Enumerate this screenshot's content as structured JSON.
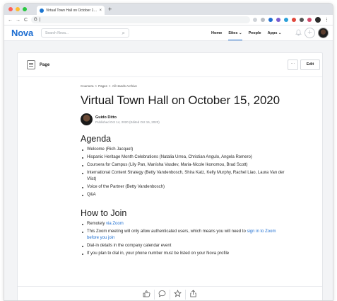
{
  "browser": {
    "tab_title": "Virtual Town Hall on October 1…",
    "tab_close": "×",
    "new_tab": "+",
    "address": "|",
    "back": "←",
    "forward": "→",
    "reload": "C",
    "lock": "G",
    "menu": "⋮"
  },
  "header": {
    "logo": "Nova",
    "search_placeholder": "Search Nova...",
    "search_icon": "⌕",
    "nav": [
      {
        "label": "Home"
      },
      {
        "label": "Sites ⌄"
      },
      {
        "label": "People"
      },
      {
        "label": "Apps ⌄"
      }
    ],
    "plus": "+",
    "bell": "🔔"
  },
  "card": {
    "page_label": "Page",
    "more": "···",
    "edit": "Edit"
  },
  "doc": {
    "breadcrumb": [
      "Coursera",
      ">",
      "Pages",
      ">",
      "All Hands Archive"
    ],
    "title": "Virtual Town Hall on October 15, 2020",
    "author_name": "Guido Ditto",
    "author_meta": "Published Oct 14, 2020 (Edited Oct 15, 2020)",
    "agenda_heading": "Agenda",
    "agenda_items": [
      "Welcome (Rich Jacquet)",
      "Hispanic Heritage Month Celebrations (Natalia Urrea, Christian Angulo, Angela Romero)",
      "Coursera for Campus (Lily Pan, Manisha Vasdev, Maria-Nicole Ikonomou, Brad Scott)",
      "International Content Strategy (Betty Vandenbosch, Shira Katz, Kelly Murphy, Rachel Liao, Laura Van der Vlist)",
      "Voice of the Partner (Betty Vandenbosch)",
      "Q&A"
    ],
    "join_heading": "How to Join",
    "join": {
      "remotely_prefix": "Remotely ",
      "remotely_link": "via Zoom",
      "zoom_text": "This Zoom meeting will only allow authenticated users, which means you will need to ",
      "zoom_link": "sign in to Zoom before you join",
      "dialin": "Dial-in details in the company calendar event",
      "phone": "If you plan to dial in, your phone number must be listed on your Nova profile"
    }
  },
  "reactions": [
    "👍",
    "💬",
    "☆",
    "⇪"
  ],
  "colors": {
    "brand": "#1f6fd1",
    "traffic_red": "#ff5f57",
    "traffic_yellow": "#febc2e",
    "traffic_green": "#28c840"
  }
}
